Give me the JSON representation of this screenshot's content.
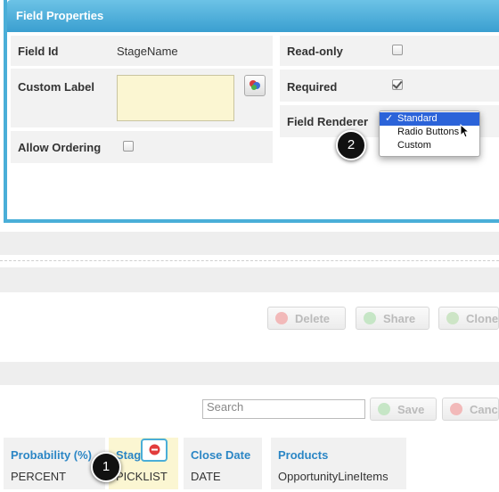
{
  "panel": {
    "title": "Field Properties",
    "field_id_label": "Field Id",
    "field_id_value": "StageName",
    "custom_label_label": "Custom Label",
    "custom_label_value": "",
    "allow_ordering_label": "Allow Ordering",
    "allow_ordering_checked": false,
    "read_only_label": "Read-only",
    "read_only_checked": false,
    "required_label": "Required",
    "required_checked": true,
    "field_renderer_label": "Field Renderer",
    "renderer_options": [
      "Standard",
      "Radio Buttons",
      "Custom"
    ],
    "renderer_selected": "Standard"
  },
  "callouts": {
    "one": "1",
    "two": "2"
  },
  "toolbar": {
    "delete_label": "Delete",
    "share_label": "Share",
    "clone_label": "Clone"
  },
  "list": {
    "search_placeholder": "Search",
    "save_label": "Save",
    "cancel_label": "Canc",
    "columns": [
      {
        "name": "Probability (%)",
        "type": "PERCENT"
      },
      {
        "name": "Stag",
        "type": "PICKLIST"
      },
      {
        "name": "Close Date",
        "type": "DATE"
      },
      {
        "name": "Products",
        "type": "OpportunityLineItems"
      }
    ]
  },
  "colors": {
    "accent": "#3a9fd0",
    "link": "#2b86c5",
    "selection": "#2b63d9",
    "textarea_bg": "#fbf6d2"
  }
}
